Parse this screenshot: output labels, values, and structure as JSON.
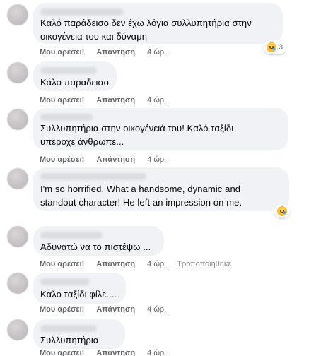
{
  "actions": {
    "like": "Μου αρέσει!",
    "reply": "Απάντηση"
  },
  "comments": [
    {
      "text": "Καλό παράδεισο δεν έχω λόγια συλλυπητήρια στην\nοικογένεια του και δύναμη",
      "time": "4 ώρ.",
      "reaction_count": "3",
      "reaction_icon": "sad-face-icon"
    },
    {
      "text": "Κάλο παραδεισο",
      "time": "4 ώρ."
    },
    {
      "text": "Συλλυπητήρια στην οικογένειά του! Καλό ταξίδι\nυπέροχε άνθρωπε...",
      "time": "4 ώρ."
    },
    {
      "text": "I'm so horrified. What a handsome, dynamic and\nstandout character! He left an impression on me.",
      "reaction_icon": "sad-face-icon"
    },
    {
      "text": "Αδυνατώ να το πιστέψω ...",
      "time": "4 ώρ.",
      "edited": "Τροποποιήθηκε"
    },
    {
      "text": "Καλο ταξίδι φίλε....",
      "time": "4 ώρ."
    },
    {
      "text": "Συλλυπητήρια",
      "time": "4 ώρ."
    }
  ]
}
